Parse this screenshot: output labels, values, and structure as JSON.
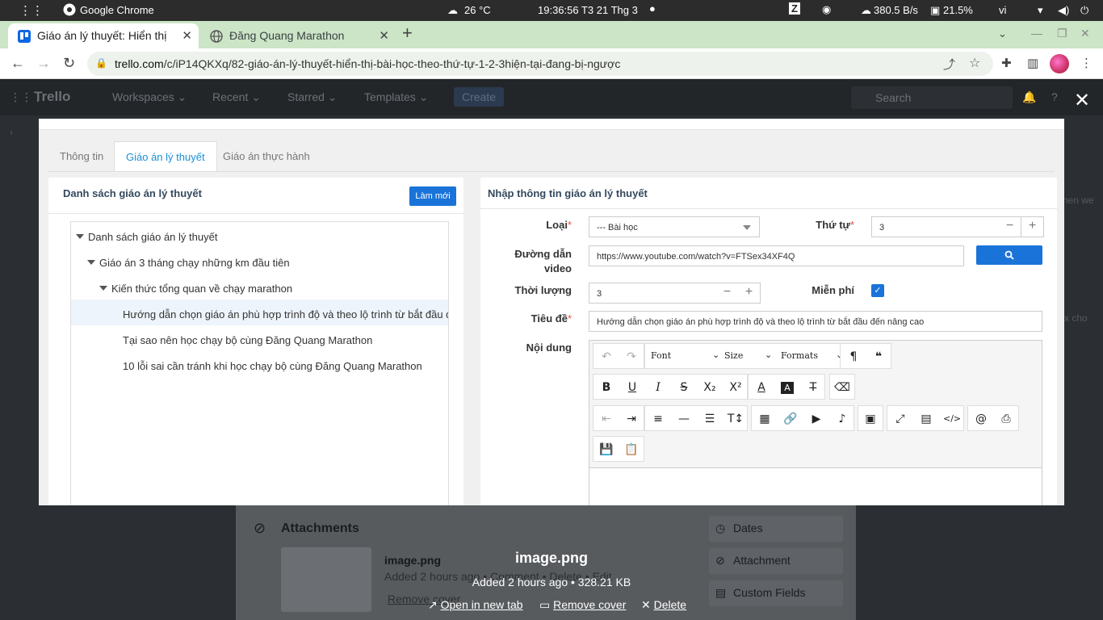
{
  "os": {
    "app_name": "Google Chrome",
    "weather": "26 °C",
    "clock": "19:36:56  T3 21 Thg 3",
    "net_speed": "380.5 B/s",
    "cpu": "21.5%",
    "lang": "vi"
  },
  "browser": {
    "tabs": [
      {
        "title": "Giáo án lý thuyết: Hiển thị",
        "active": true
      },
      {
        "title": "Đăng Quang Marathon",
        "active": false
      }
    ],
    "url_host": "trello.com",
    "url_path": "/c/iP14QKXq/82-giáo-án-lý-thuyết-hiển-thị-bài-học-theo-thứ-tự-1-2-3hiện-tại-đang-bị-ngược"
  },
  "trello": {
    "logo": "Trello",
    "nav": [
      "Workspaces",
      "Recent",
      "Starred",
      "Templates"
    ],
    "create": "Create",
    "search_placeholder": "Search",
    "attachments_title": "Attachments",
    "file_name": "image.png",
    "file_meta": "Added 2 hours ago • Comment • Delete • Edit",
    "remove_cover": "Remove cover",
    "side_buttons": [
      "Dates",
      "Attachment",
      "Custom Fields"
    ],
    "overlay": {
      "name": "image.png",
      "meta": "Added 2 hours ago • 328.21 KB",
      "open_new_tab": "Open in new tab",
      "remove_cover": "Remove cover",
      "delete": "Delete"
    },
    "side_fragments": [
      "nen we",
      "x cho"
    ]
  },
  "modal": {
    "tabs": [
      "Thông tin",
      "Giáo án lý thuyết",
      "Giáo án thực hành"
    ],
    "active_tab": 1,
    "left": {
      "title": "Danh sách giáo án lý thuyết",
      "new_button": "Làm mới",
      "tree": [
        {
          "label": "Danh sách giáo án lý thuyết",
          "level": 0,
          "expanded": true
        },
        {
          "label": "Giáo án 3 tháng chạy những km đầu tiên",
          "level": 1,
          "expanded": true
        },
        {
          "label": "Kiến thức tổng quan về chạy marathon",
          "level": 2,
          "expanded": true
        },
        {
          "label": "Hướng dẫn chọn giáo án phù hợp trình độ và theo lộ trình từ bắt đầu đến",
          "level": 3,
          "selected": true
        },
        {
          "label": "Tại sao nên học chạy bộ cùng Đăng Quang Marathon",
          "level": 3
        },
        {
          "label": "10 lỗi sai cần tránh khi học chạy bộ cùng Đăng Quang Marathon",
          "level": 3
        }
      ]
    },
    "right": {
      "title": "Nhập thông tin giáo án lý thuyết",
      "type_label": "Loại",
      "type_value": "--- Bài học",
      "order_label": "Thứ tự",
      "order_value": "3",
      "video_label_1": "Đường dẫn",
      "video_label_2": "video",
      "video_value": "https://www.youtube.com/watch?v=FTSex34XF4Q",
      "duration_label": "Thời lượng",
      "duration_value": "3",
      "free_label": "Miễn phí",
      "free_checked": true,
      "title_label": "Tiêu đề",
      "title_value": "Hướng dẫn chọn giáo án phù hợp trình độ và theo lộ trình từ bắt đầu đến nâng cao",
      "content_label": "Nội dung",
      "editor": {
        "font": "Font",
        "size": "Size",
        "formats": "Formats"
      }
    }
  }
}
